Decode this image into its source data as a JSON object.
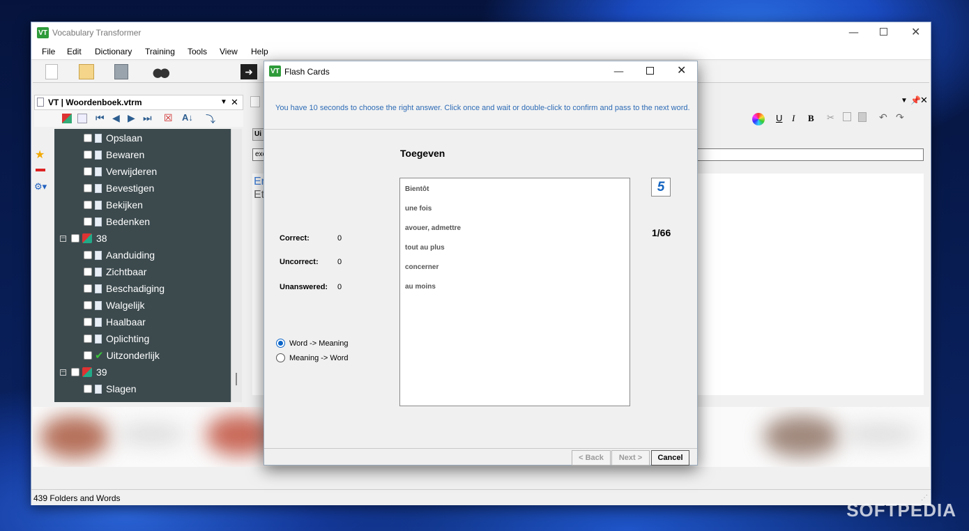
{
  "app": {
    "title": "Vocabulary Transformer",
    "logo": "VT",
    "menu": [
      "File",
      "Edit",
      "Dictionary",
      "Training",
      "Tools",
      "View",
      "Help"
    ],
    "panel_title": "VT | Woordenboek.vtrm",
    "status": "439 Folders and Words",
    "right_field_prefix": "exc",
    "right_tab_prefix": "Ui",
    "right_text_line1": "Er",
    "right_text_line2": "Et",
    "format_buttons": [
      "U",
      "I",
      "B"
    ]
  },
  "tree": {
    "items": [
      {
        "label": "Opslaan",
        "kind": "word"
      },
      {
        "label": "Bewaren",
        "kind": "word"
      },
      {
        "label": "Verwijderen",
        "kind": "word"
      },
      {
        "label": "Bevestigen",
        "kind": "word"
      },
      {
        "label": "Bekijken",
        "kind": "word"
      },
      {
        "label": "Bedenken",
        "kind": "word"
      },
      {
        "label": "38",
        "kind": "group"
      },
      {
        "label": "Aanduiding",
        "kind": "word"
      },
      {
        "label": "Zichtbaar",
        "kind": "word"
      },
      {
        "label": "Beschadiging",
        "kind": "word"
      },
      {
        "label": "Walgelijk",
        "kind": "word"
      },
      {
        "label": "Haalbaar",
        "kind": "word"
      },
      {
        "label": "Oplichting",
        "kind": "word"
      },
      {
        "label": "Uitzonderlijk",
        "kind": "checked"
      },
      {
        "label": "39",
        "kind": "group"
      },
      {
        "label": "Slagen",
        "kind": "word"
      }
    ]
  },
  "dialog": {
    "title": "Flash Cards",
    "instructions": "You have 10 seconds to choose the right answer.  Click once and wait or double-click to confirm and pass to the next word.",
    "word": "Toegeven",
    "options": [
      "Bientôt",
      "une fois",
      "avouer, admettre",
      "tout au plus",
      "concerner",
      "au moins"
    ],
    "timer": "5",
    "progress": "1/66",
    "stats": {
      "correct_label": "Correct:",
      "correct_value": "0",
      "uncorrect_label": "Uncorrect:",
      "uncorrect_value": "0",
      "unanswered_label": "Unanswered:",
      "unanswered_value": "0"
    },
    "mode_options": [
      "Word -> Meaning",
      "Meaning -> Word"
    ],
    "mode_selected": "Word -> Meaning",
    "buttons": {
      "back": "< Back",
      "next": "Next >",
      "cancel": "Cancel"
    }
  },
  "watermark": "SOFTPEDIA",
  "colors": {
    "accent": "#0a64c8",
    "tree_bg": "#3c4a4e",
    "logo_green": "#2e9b3a"
  }
}
